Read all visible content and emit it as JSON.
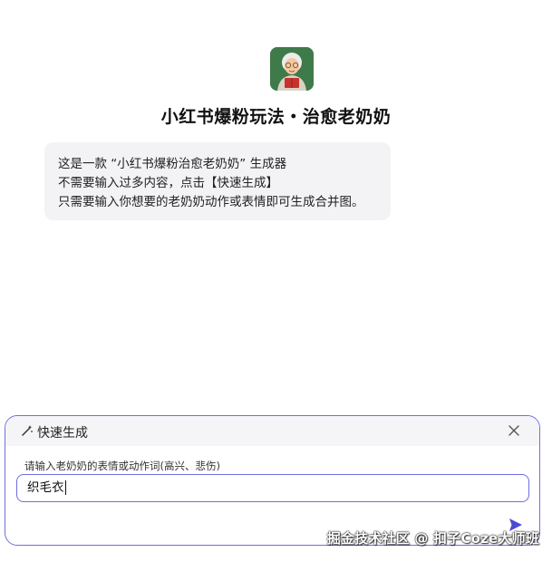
{
  "bot": {
    "avatar_icon": "grandma-avatar-icon",
    "title": "小红书爆粉玩法・治愈老奶奶"
  },
  "intro": {
    "lines": [
      "这是一款 “小红书爆粉治愈老奶奶” 生成器",
      "不需要输入过多内容，点击【快速生成】",
      "只需要输入你想要的老奶奶动作或表情即可生成合并图。"
    ]
  },
  "shortcut_panel": {
    "title": "快速生成",
    "header_icon": "magic-wand-icon",
    "close_icon": "close-icon",
    "field_label": "请输入老奶奶的表情或动作词(高兴、悲伤)",
    "field_value": "织毛衣",
    "send_icon": "send-arrow-icon"
  },
  "colors": {
    "accent": "#6f6fe0",
    "bubble_bg": "#f3f3f5",
    "send": "#4b4bd1"
  },
  "watermark": "掘金技术社区 @ 扣子Coze大师班"
}
